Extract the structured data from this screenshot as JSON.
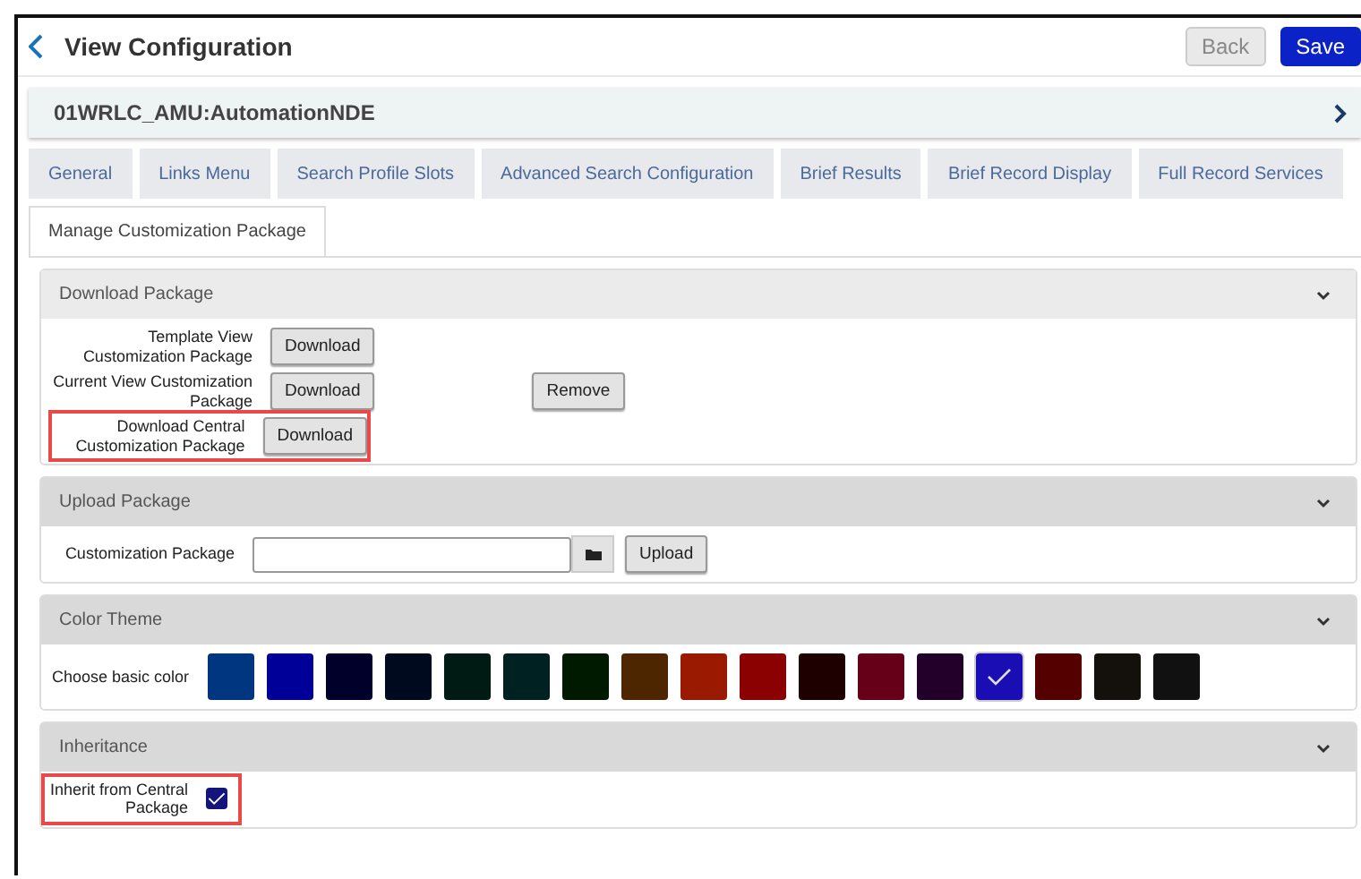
{
  "header": {
    "title": "View Configuration",
    "buttons": [
      {
        "label": "Back",
        "kind": "secondary"
      },
      {
        "label": "Save",
        "kind": "primary"
      }
    ]
  },
  "entity": {
    "name": "01WRLC_AMU:AutomationNDE"
  },
  "tabs": [
    {
      "label": "General",
      "selected": false
    },
    {
      "label": "Links Menu",
      "selected": false
    },
    {
      "label": "Search Profile Slots",
      "selected": false
    },
    {
      "label": "Advanced Search Configuration",
      "selected": false
    },
    {
      "label": "Brief Results",
      "selected": false
    },
    {
      "label": "Brief Record Display",
      "selected": false
    },
    {
      "label": "Full Record Services",
      "selected": false
    },
    {
      "label": "Manage Customization Package",
      "selected": true
    }
  ],
  "download_package": {
    "title": "Download Package",
    "rows": [
      {
        "label": "Template View Customization Package",
        "button": "Download",
        "highlighted": false
      },
      {
        "label": "Current View Customization Package",
        "button": "Download",
        "extra_button": "Remove",
        "highlighted": false
      },
      {
        "label": "Download Central Customization Package",
        "button": "Download",
        "highlighted": true
      }
    ]
  },
  "upload_package": {
    "title": "Upload Package",
    "label": "Customization Package",
    "button": "Upload"
  },
  "color_theme": {
    "title": "Color Theme",
    "label": "Choose basic color",
    "swatches": [
      {
        "color": "#003580",
        "selected": false
      },
      {
        "color": "#000099",
        "selected": false
      },
      {
        "color": "#00002a",
        "selected": false
      },
      {
        "color": "#000a1f",
        "selected": false
      },
      {
        "color": "#001a14",
        "selected": false
      },
      {
        "color": "#002121",
        "selected": false
      },
      {
        "color": "#001a00",
        "selected": false
      },
      {
        "color": "#4d2600",
        "selected": false
      },
      {
        "color": "#991a00",
        "selected": false
      },
      {
        "color": "#8b0000",
        "selected": false
      },
      {
        "color": "#1f0000",
        "selected": false
      },
      {
        "color": "#660018",
        "selected": false
      },
      {
        "color": "#22002a",
        "selected": false
      },
      {
        "color": "#1a0db3",
        "selected": true
      },
      {
        "color": "#550000",
        "selected": false
      },
      {
        "color": "#14110d",
        "selected": false
      },
      {
        "color": "#111111",
        "selected": false
      }
    ]
  },
  "inheritance": {
    "title": "Inheritance",
    "label": "Inherit from Central Package",
    "checked": true,
    "highlighted": true
  }
}
